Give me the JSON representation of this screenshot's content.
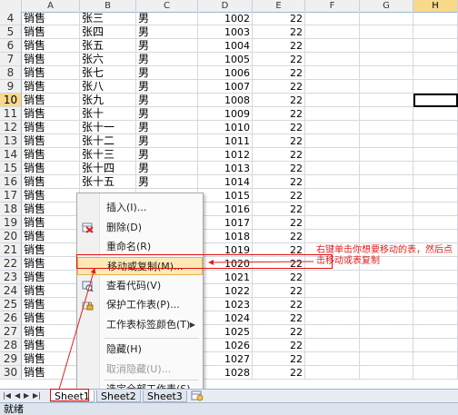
{
  "columns": [
    "A",
    "B",
    "C",
    "D",
    "E",
    "F",
    "G",
    "H"
  ],
  "rows": [
    {
      "n": "4",
      "a": "销售",
      "b": "张三",
      "c": "男",
      "d": "1002",
      "e": "22"
    },
    {
      "n": "5",
      "a": "销售",
      "b": "张四",
      "c": "男",
      "d": "1003",
      "e": "22"
    },
    {
      "n": "6",
      "a": "销售",
      "b": "张五",
      "c": "男",
      "d": "1004",
      "e": "22"
    },
    {
      "n": "7",
      "a": "销售",
      "b": "张六",
      "c": "男",
      "d": "1005",
      "e": "22"
    },
    {
      "n": "8",
      "a": "销售",
      "b": "张七",
      "c": "男",
      "d": "1006",
      "e": "22"
    },
    {
      "n": "9",
      "a": "销售",
      "b": "张八",
      "c": "男",
      "d": "1007",
      "e": "22"
    },
    {
      "n": "10",
      "a": "销售",
      "b": "张九",
      "c": "男",
      "d": "1008",
      "e": "22"
    },
    {
      "n": "11",
      "a": "销售",
      "b": "张十",
      "c": "男",
      "d": "1009",
      "e": "22"
    },
    {
      "n": "12",
      "a": "销售",
      "b": "张十一",
      "c": "男",
      "d": "1010",
      "e": "22"
    },
    {
      "n": "13",
      "a": "销售",
      "b": "张十二",
      "c": "男",
      "d": "1011",
      "e": "22"
    },
    {
      "n": "14",
      "a": "销售",
      "b": "张十三",
      "c": "男",
      "d": "1012",
      "e": "22"
    },
    {
      "n": "15",
      "a": "销售",
      "b": "张十四",
      "c": "男",
      "d": "1013",
      "e": "22"
    },
    {
      "n": "16",
      "a": "销售",
      "b": "张十五",
      "c": "男",
      "d": "1014",
      "e": "22"
    },
    {
      "n": "17",
      "a": "销售",
      "b": "",
      "c": "",
      "d": "1015",
      "e": "22"
    },
    {
      "n": "18",
      "a": "销售",
      "b": "",
      "c": "",
      "d": "1016",
      "e": "22"
    },
    {
      "n": "19",
      "a": "销售",
      "b": "",
      "c": "",
      "d": "1017",
      "e": "22"
    },
    {
      "n": "20",
      "a": "销售",
      "b": "",
      "c": "",
      "d": "1018",
      "e": "22"
    },
    {
      "n": "21",
      "a": "销售",
      "b": "",
      "c": "",
      "d": "1019",
      "e": "22"
    },
    {
      "n": "22",
      "a": "销售",
      "b": "",
      "c": "",
      "d": "1020",
      "e": "22"
    },
    {
      "n": "23",
      "a": "销售",
      "b": "",
      "c": "",
      "d": "1021",
      "e": "22"
    },
    {
      "n": "24",
      "a": "销售",
      "b": "",
      "c": "",
      "d": "1022",
      "e": "22"
    },
    {
      "n": "25",
      "a": "销售",
      "b": "",
      "c": "",
      "d": "1023",
      "e": "22"
    },
    {
      "n": "26",
      "a": "销售",
      "b": "",
      "c": "",
      "d": "1024",
      "e": "22"
    },
    {
      "n": "27",
      "a": "销售",
      "b": "",
      "c": "",
      "d": "1025",
      "e": "22"
    },
    {
      "n": "28",
      "a": "销售",
      "b": "",
      "c": "",
      "d": "1026",
      "e": "22"
    },
    {
      "n": "29",
      "a": "销售",
      "b": "",
      "c": "",
      "d": "1027",
      "e": "22"
    },
    {
      "n": "30",
      "a": "销售",
      "b": "",
      "c": "",
      "d": "1028",
      "e": "22"
    }
  ],
  "selected_row": "10",
  "selected_column": "H",
  "context_menu": {
    "insert": "插入(I)...",
    "delete": "删除(D)",
    "rename": "重命名(R)",
    "move_copy": "移动或复制(M)...",
    "view_code": "查看代码(V)",
    "protect": "保护工作表(P)...",
    "tab_color": "工作表标签颜色(T)",
    "hide": "隐藏(H)",
    "unhide": "取消隐藏(U)...",
    "select_all": "选定全部工作表(S)"
  },
  "sheet_tabs": [
    "Sheet1",
    "Sheet2",
    "Sheet3"
  ],
  "status": "就绪",
  "annotation": "右键单击你想要移动的表，然后点击移动或表复制",
  "colors": {
    "accent": "#e02020",
    "highlight": "#fce9b4",
    "header_selected": "#f9d98a"
  }
}
